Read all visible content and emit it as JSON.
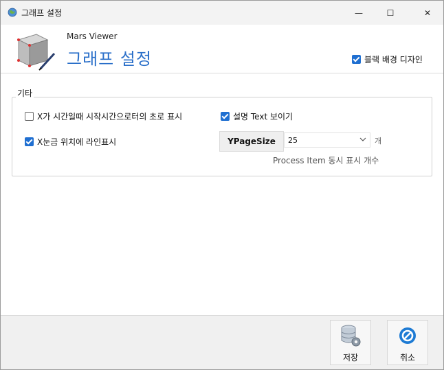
{
  "window": {
    "title": "그래프 설정",
    "controls": {
      "minimize": "—",
      "maximize": "☐",
      "close": "✕"
    }
  },
  "header": {
    "app_name": "Mars Viewer",
    "title": "그래프 설정",
    "black_bg_label": "블랙 배경 디자인",
    "black_bg_checked": true,
    "title_color": "#2a6fc9"
  },
  "group": {
    "title": "기타",
    "options": [
      {
        "label": "X가 시간일때 시작시간으로터의 초로 표시",
        "checked": false
      },
      {
        "label": "설명 Text 보이기",
        "checked": true
      },
      {
        "label": "X눈금 위치에 라인표시",
        "checked": true
      }
    ],
    "ypage": {
      "button_label": "YPageSize",
      "selected": "25",
      "unit": "개",
      "caption": "Process Item 동시 표시 개수"
    }
  },
  "footer": {
    "save_label": "저장",
    "cancel_label": "취소",
    "save_icon": "database-settings-icon",
    "cancel_icon": "cancel-circle-icon"
  },
  "colors": {
    "accent": "#1f6fd1",
    "cancel_icon": "#1e7bd4"
  }
}
